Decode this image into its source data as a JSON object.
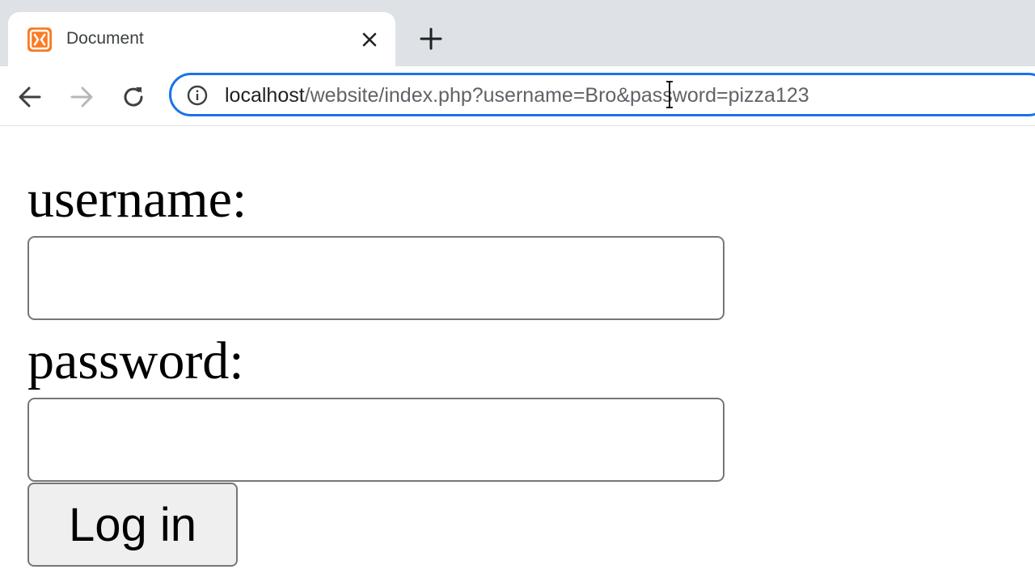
{
  "browser": {
    "tab": {
      "title": "Document"
    },
    "address_bar": {
      "host": "localhost",
      "path": "/website/index.php?username=Bro&password=pizza123"
    }
  },
  "form": {
    "username_label": "username:",
    "username_value": "",
    "password_label": "password:",
    "password_value": "",
    "submit_label": "Log in"
  },
  "colors": {
    "omnibox_focus": "#1a73e8",
    "xampp_orange": "#fb7a24",
    "tab_strip": "#dee1e6"
  },
  "icons": {
    "favicon": "xampp-icon",
    "close": "close-icon",
    "new_tab": "plus-icon",
    "back": "arrow-left-icon",
    "forward": "arrow-right-icon",
    "reload": "reload-icon",
    "info": "info-icon",
    "cursor": "text-cursor-icon"
  }
}
